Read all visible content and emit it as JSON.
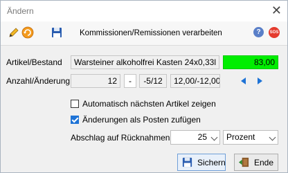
{
  "window": {
    "title": "Ändern",
    "close_glyph": "✕"
  },
  "toolbar": {
    "title": "Kommissionen/Remissionen verarbeiten",
    "icons": [
      "pencil-icon",
      "refresh-icon",
      "save-disk-icon",
      "help-icon",
      "sos-icon"
    ],
    "help_glyph": "?",
    "sos_text": "SOS"
  },
  "form": {
    "artikel_label": "Artikel/Bestand",
    "artikel_name": "Warsteiner alkoholfrei Kasten 24x0,33l",
    "bestand": "83,00",
    "anzahl_label": "Anzahl/Änderung",
    "anzahl": "12",
    "minus": "-",
    "aenderung": "-5/12",
    "result": "12,00/-12,00",
    "auto_next_label": "Automatisch nächsten Artikel zeigen",
    "auto_next_checked": false,
    "add_posten_label": "Änderungen als Posten zufügen",
    "add_posten_checked": true,
    "abschlag_label": "Abschlag auf Rücknahmen",
    "abschlag_value": "25",
    "abschlag_unit": "Prozent"
  },
  "buttons": {
    "save": "Sichern",
    "end": "Ende"
  },
  "colors": {
    "bestand_bg": "#00ee00",
    "accent": "#1e73d6"
  }
}
